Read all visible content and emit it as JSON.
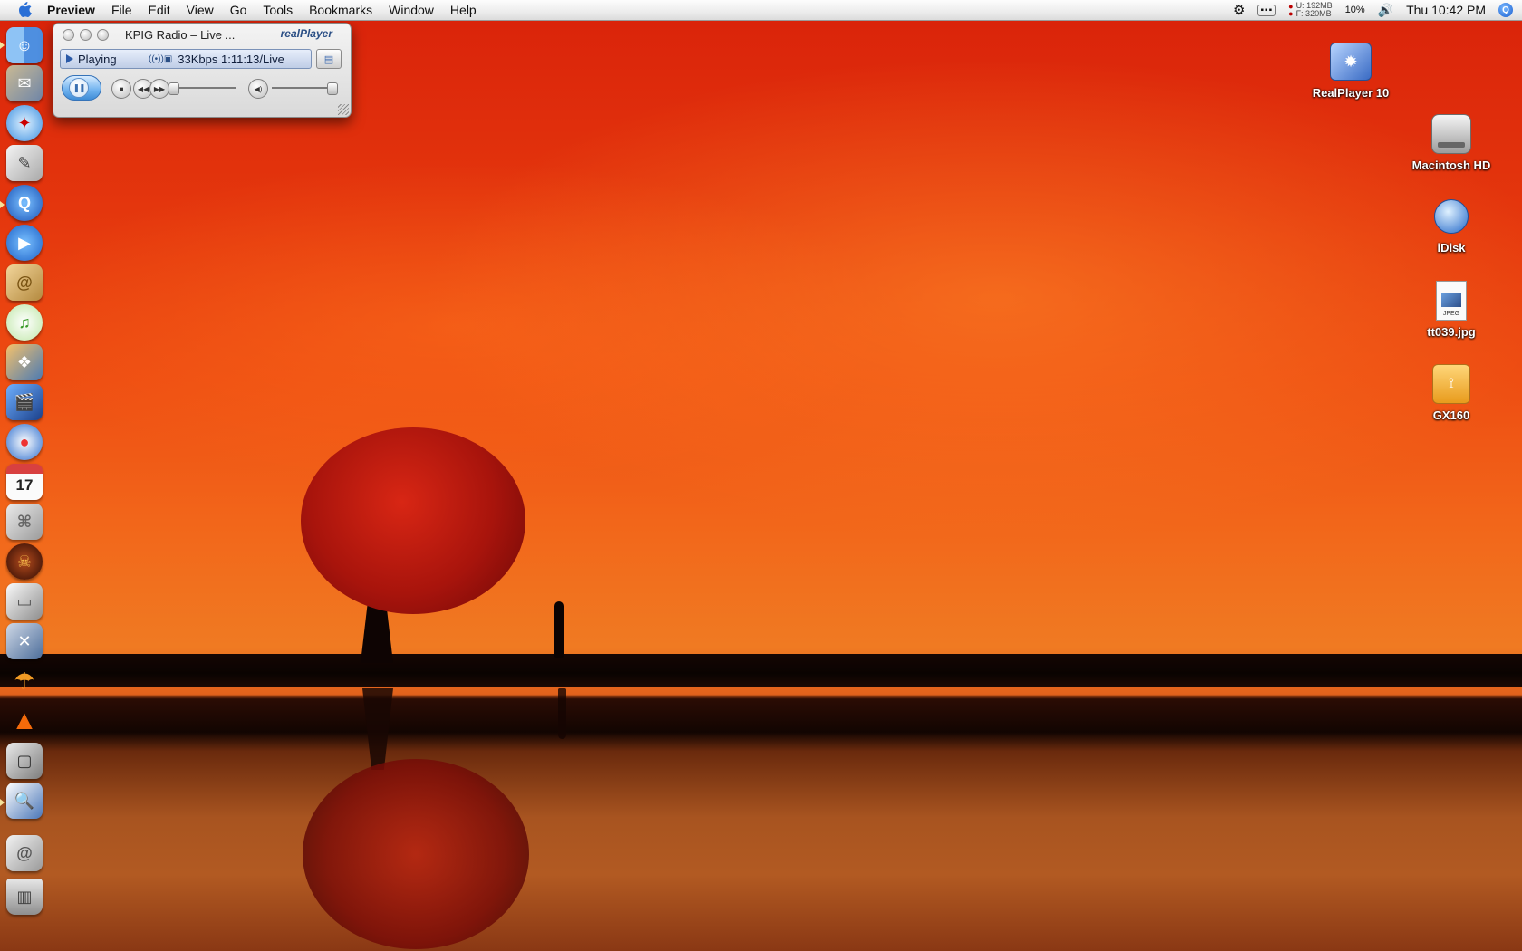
{
  "menubar": {
    "app_name": "Preview",
    "menus": [
      "File",
      "Edit",
      "View",
      "Go",
      "Tools",
      "Bookmarks",
      "Window",
      "Help"
    ],
    "memory_used": "U: 192MB",
    "memory_free": "F: 320MB",
    "cpu": "10%",
    "clock": "Thu 10:42 PM"
  },
  "player": {
    "title": "KPIG Radio – Live ...",
    "logo": "realPlayer",
    "status": "Playing",
    "rate": "33Kbps 1:11:13/Live",
    "volume_level": 0.95
  },
  "desktop_icons": [
    {
      "label": "RealPlayer 10",
      "icon": "realplayer-icon"
    },
    {
      "label": "Macintosh HD",
      "icon": "hard-drive-icon"
    },
    {
      "label": "iDisk",
      "icon": "idisk-icon"
    },
    {
      "label": "tt039.jpg",
      "icon": "jpeg-file-icon",
      "badge": "JPEG"
    },
    {
      "label": "GX160",
      "icon": "usb-drive-icon"
    }
  ],
  "dock": {
    "calendar_day": "17",
    "items": [
      "finder",
      "mail-stamp",
      "safari",
      "textedit",
      "real-q",
      "ichat",
      "address-book",
      "itunes",
      "iphoto",
      "imovie",
      "idvd",
      "ical",
      "system-prefs",
      "diablo",
      "disk",
      "utilities",
      "umbrella",
      "vlc",
      "terminal",
      "preview",
      "mail-spring",
      "trash"
    ]
  },
  "colors": {
    "sky_top": "#d9220a",
    "sky_glow": "#f07a22",
    "player_blue": "#3f8cd6",
    "menubar": "#ececec"
  }
}
